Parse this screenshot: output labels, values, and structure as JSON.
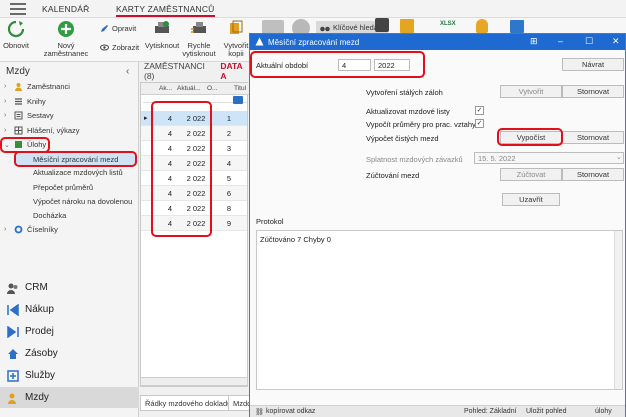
{
  "top_tabs": [
    "KALENDÁŘ",
    "KARTY ZAMĚSTNANCŮ"
  ],
  "ribbon": {
    "obnovit": "Obnovit",
    "novy": "Nový zaměstnanec",
    "opravit": "Opravit",
    "zobrazit": "Zobrazit",
    "vytisknout": "Vytisknout",
    "rychle1": "Rychle",
    "rychle2": "vytisknout",
    "vytvorit1": "Vytvořit",
    "vytvorit2": "kopii",
    "klicove": "Klíčové hledání",
    "xlsx": "XLSX"
  },
  "leftnav": {
    "title": "Mzdy",
    "collapse": "‹",
    "tree": [
      "Zaměstnanci",
      "Knihy",
      "Sestavy",
      "Hlášení, výkazy",
      "Úlohy",
      "Měsíční zpracování mezd",
      "Aktualizace mzdových listů",
      "Přepočet průměrů",
      "Výpočet nároku na dovolenou",
      "Docházka",
      "Číselníky"
    ],
    "modules": [
      "CRM",
      "Nákup",
      "Prodej",
      "Zásoby",
      "Služby",
      "Mzdy"
    ]
  },
  "main": {
    "header": "ZAMĚSTNANCI (8)",
    "header_red": "DATA A",
    "columns": [
      "Ak...",
      "Aktuál...",
      "O...",
      "Titul"
    ],
    "rows": [
      {
        "a": "4",
        "b": "2 022",
        "c": "1"
      },
      {
        "a": "4",
        "b": "2 022",
        "c": "2"
      },
      {
        "a": "4",
        "b": "2 022",
        "c": "3"
      },
      {
        "a": "4",
        "b": "2 022",
        "c": "4"
      },
      {
        "a": "4",
        "b": "2 022",
        "c": "5"
      },
      {
        "a": "4",
        "b": "2 022",
        "c": "6"
      },
      {
        "a": "4",
        "b": "2 022",
        "c": "8"
      },
      {
        "a": "4",
        "b": "2 022",
        "c": "9"
      }
    ],
    "bottom_tabs": [
      "Řádky mzdového dokladu",
      "Mzdo"
    ]
  },
  "dialog": {
    "title": "Měsíční zpracování mezd",
    "obdobi_label": "Aktuální období",
    "month": "4",
    "year": "2022",
    "navrat": "Návrat",
    "stale_label": "Vytvoření stálých záloh",
    "vytvorit": "Vytvořit",
    "stornovat": "Stornovat",
    "aktualizovat_label": "Aktualizovat mzdové listy",
    "prumery_label": "Vypočít průměry pro prac. vztahy",
    "vypocet_label": "Výpočet čistých mezd",
    "vypocist": "Vypočíst",
    "splatnost_label": "Splatnost mzdových závazků",
    "splatnost_value": "15. 5. 2022",
    "zuctovani_label": "Zúčtování mezd",
    "zuctovat": "Zúčtovat",
    "uzavrit": "Uzavřít",
    "protokol_label": "Protokol",
    "protokol_text": "Zúčtováno 7 Chyby 0",
    "status_left": "kopírovat odkaz",
    "status_pohled": "Pohled: Základní",
    "status_ulozit": "Uložit pohled",
    "status_ulohy": "úlohy"
  }
}
